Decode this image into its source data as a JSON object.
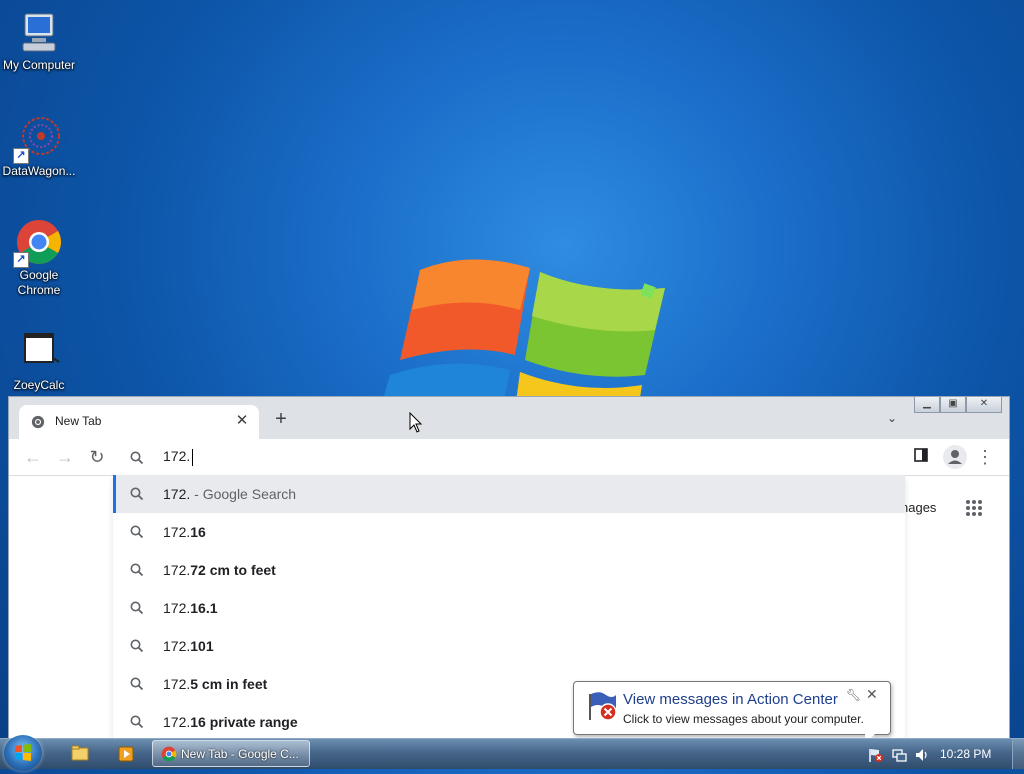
{
  "desktop": {
    "icons": [
      {
        "label": "My Computer",
        "icon": "computer-icon"
      },
      {
        "label": "DataWagon...",
        "icon": "datawagon-icon"
      },
      {
        "label": "Google Chrome",
        "icon": "chrome-icon"
      },
      {
        "label": "ZoeyCalc",
        "icon": "zoeycalc-icon"
      }
    ]
  },
  "browser": {
    "tab": {
      "title": "New Tab",
      "close_label": "✕"
    },
    "new_tab_label": "+",
    "omnibox": {
      "value": "172."
    },
    "suggestions": [
      {
        "prefix": "172.",
        "bold": "",
        "desc": " - Google Search",
        "selected": true
      },
      {
        "prefix": "172.",
        "bold": "16",
        "desc": ""
      },
      {
        "prefix": "172.",
        "bold": "72 cm to feet",
        "desc": ""
      },
      {
        "prefix": "172.",
        "bold": "16.1",
        "desc": ""
      },
      {
        "prefix": "172.",
        "bold": "101",
        "desc": ""
      },
      {
        "prefix": "172.",
        "bold": "5 cm in feet",
        "desc": ""
      },
      {
        "prefix": "172.",
        "bold": "16 private range",
        "desc": ""
      }
    ],
    "images_link": "nages"
  },
  "notification": {
    "title": "View messages in Action Center",
    "text": "Click to view messages about your computer.",
    "close_label": "✕"
  },
  "taskbar": {
    "task_label": "New Tab - Google C...",
    "clock": "10:28 PM"
  },
  "colors": {
    "accent": "#1a73e8",
    "notification_title": "#1e3f8c"
  }
}
